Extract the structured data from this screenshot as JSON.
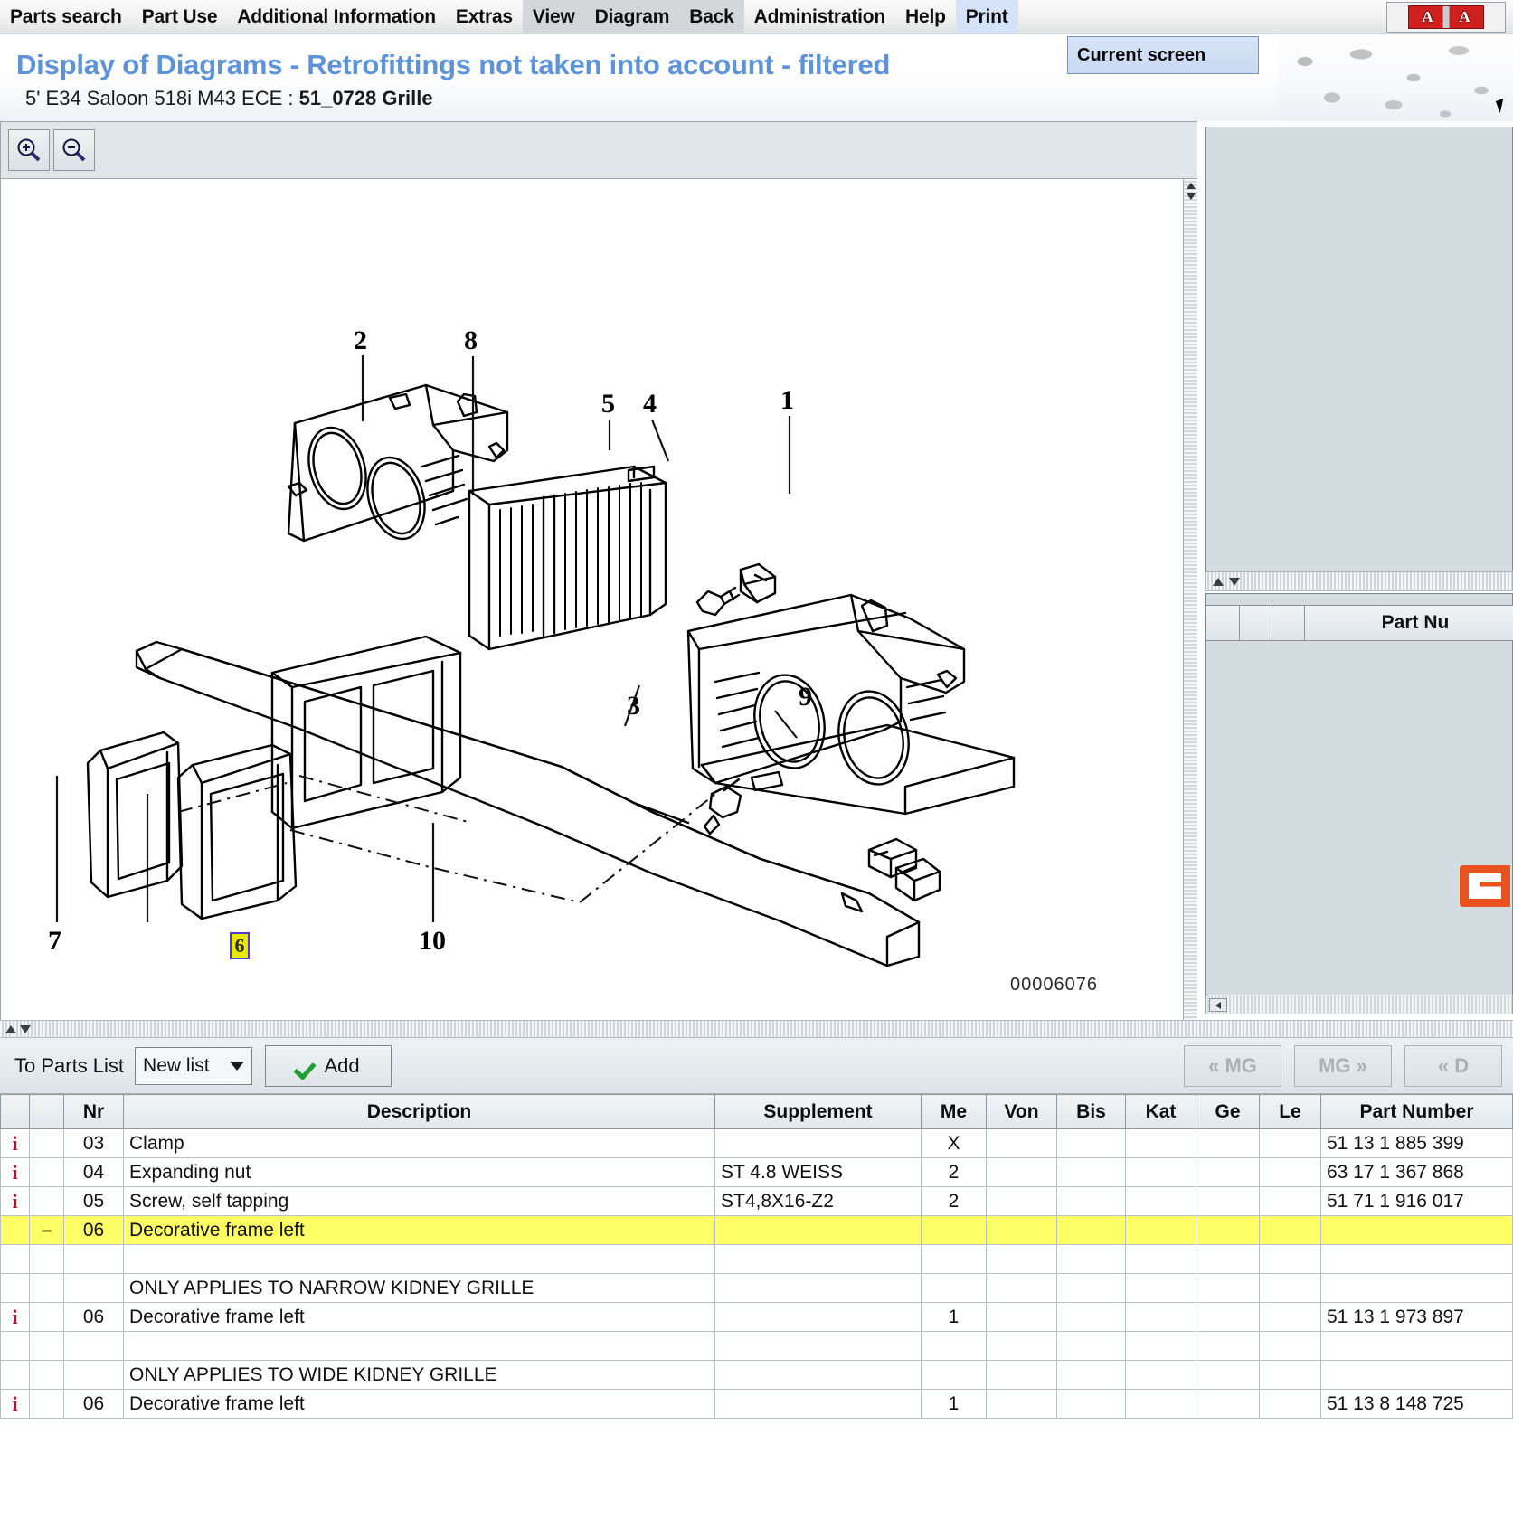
{
  "menu": {
    "items": [
      {
        "label": "Parts search",
        "state": "normal"
      },
      {
        "label": "Part Use",
        "state": "normal"
      },
      {
        "label": "Additional Information",
        "state": "normal"
      },
      {
        "label": "Extras",
        "state": "normal"
      },
      {
        "label": "View",
        "state": "dim"
      },
      {
        "label": "Diagram",
        "state": "dim"
      },
      {
        "label": "Back",
        "state": "dim"
      },
      {
        "label": "Administration",
        "state": "normal"
      },
      {
        "label": "Help",
        "state": "normal"
      },
      {
        "label": "Print",
        "state": "open"
      }
    ],
    "dropdown": {
      "label": "Current screen"
    }
  },
  "header": {
    "title": "Display of Diagrams - Retrofittings not taken into account - filtered",
    "subtitle_prefix": "5' E34 Saloon 518i M43 ECE : ",
    "subtitle_bold": "51_0728 Grille"
  },
  "toolbar": {
    "zoom_in": "zoom-in",
    "zoom_out": "zoom-out"
  },
  "diagram": {
    "code": "00006076",
    "callouts": [
      "1",
      "2",
      "3",
      "4",
      "5",
      "6",
      "7",
      "8",
      "9",
      "10"
    ],
    "highlighted_callout": "6",
    "highlight_fill": "#e8e800",
    "highlight_border": "#4b3ccf"
  },
  "right_panel": {
    "bottom_header_label": "Part Nu"
  },
  "parts_toolbar": {
    "to_parts_list_label": "To Parts List",
    "list_select_value": "New list",
    "add_label": "Add",
    "nav_buttons": [
      "« MG",
      "MG »",
      "« D"
    ]
  },
  "parts_table": {
    "columns": [
      "",
      "",
      "Nr",
      "Description",
      "Supplement",
      "Me",
      "Von",
      "Bis",
      "Kat",
      "Ge",
      "Le",
      "Part Number"
    ],
    "rows": [
      {
        "info": "i",
        "mark": "",
        "nr": "03",
        "description": "Clamp",
        "supplement": "",
        "me": "X",
        "von": "",
        "bis": "",
        "kat": "",
        "ge": "",
        "le": "",
        "part_number": "51 13 1 885 399",
        "highlight": false
      },
      {
        "info": "i",
        "mark": "",
        "nr": "04",
        "description": "Expanding nut",
        "supplement": "ST 4.8 WEISS",
        "me": "2",
        "von": "",
        "bis": "",
        "kat": "",
        "ge": "",
        "le": "",
        "part_number": "63 17 1 367 868",
        "highlight": false
      },
      {
        "info": "i",
        "mark": "",
        "nr": "05",
        "description": "Screw, self tapping",
        "supplement": "ST4,8X16-Z2",
        "me": "2",
        "von": "",
        "bis": "",
        "kat": "",
        "ge": "",
        "le": "",
        "part_number": "51 71 1 916 017",
        "highlight": false
      },
      {
        "info": "",
        "mark": "–",
        "nr": "06",
        "description": "Decorative frame left",
        "supplement": "",
        "me": "",
        "von": "",
        "bis": "",
        "kat": "",
        "ge": "",
        "le": "",
        "part_number": "",
        "highlight": true
      },
      {
        "info": "",
        "mark": "",
        "nr": "",
        "description": "",
        "supplement": "",
        "me": "",
        "von": "",
        "bis": "",
        "kat": "",
        "ge": "",
        "le": "",
        "part_number": "",
        "highlight": false
      },
      {
        "info": "",
        "mark": "",
        "nr": "",
        "description": "ONLY APPLIES TO NARROW KIDNEY GRILLE",
        "supplement": "",
        "me": "",
        "von": "",
        "bis": "",
        "kat": "",
        "ge": "",
        "le": "",
        "part_number": "",
        "highlight": false
      },
      {
        "info": "i",
        "mark": "",
        "nr": "06",
        "description": "Decorative frame left",
        "supplement": "",
        "me": "1",
        "von": "",
        "bis": "",
        "kat": "",
        "ge": "",
        "le": "",
        "part_number": "51 13 1 973 897",
        "highlight": false
      },
      {
        "info": "",
        "mark": "",
        "nr": "",
        "description": "",
        "supplement": "",
        "me": "",
        "von": "",
        "bis": "",
        "kat": "",
        "ge": "",
        "le": "",
        "part_number": "",
        "highlight": false
      },
      {
        "info": "",
        "mark": "",
        "nr": "",
        "description": "ONLY APPLIES TO WIDE KIDNEY GRILLE",
        "supplement": "",
        "me": "",
        "von": "",
        "bis": "",
        "kat": "",
        "ge": "",
        "le": "",
        "part_number": "",
        "highlight": false
      },
      {
        "info": "i",
        "mark": "",
        "nr": "06",
        "description": "Decorative frame left",
        "supplement": "",
        "me": "1",
        "von": "",
        "bis": "",
        "kat": "",
        "ge": "",
        "le": "",
        "part_number": "51 13 8 148 725",
        "highlight": false
      }
    ]
  },
  "colors": {
    "title_blue": "#5d93d8",
    "highlight_row": "#ffff66",
    "info_icon": "#b11932",
    "menu_open_bg": "#d5e2f7",
    "panel_bg": "#d3dce0"
  }
}
